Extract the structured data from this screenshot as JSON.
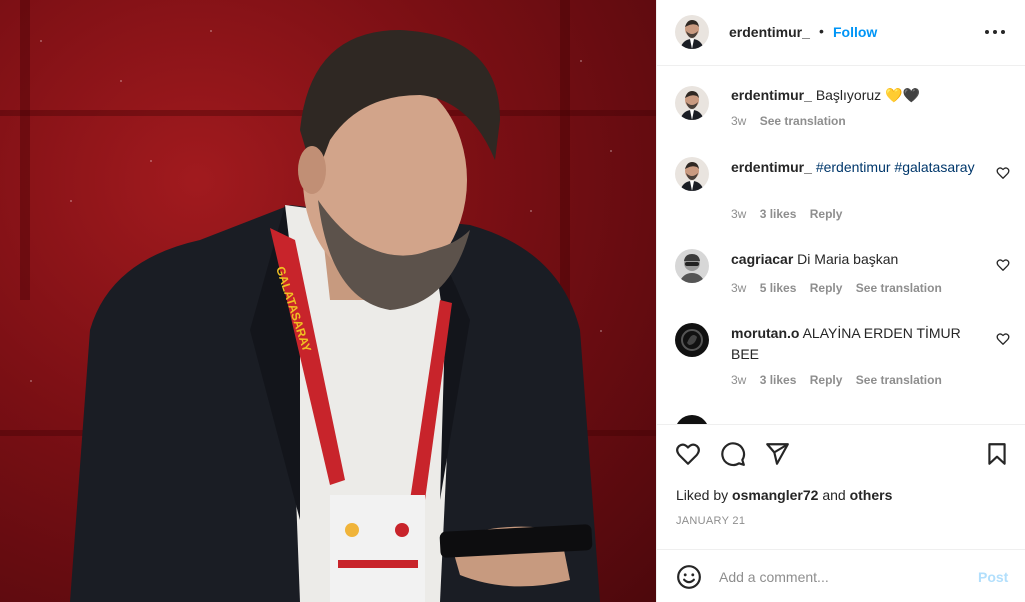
{
  "post": {
    "author": "erdentimur_",
    "separator": "•",
    "follow_label": "Follow",
    "more_icon": "more-horizontal-icon"
  },
  "caption": {
    "username": "erdentimur_",
    "text": "Başlıyoruz",
    "emoji": "💛🖤",
    "time": "3w",
    "translate": "See translation"
  },
  "comments": [
    {
      "username": "erdentimur_",
      "text": "#erdentimur #galatasaray",
      "time": "3w",
      "likes": "3 likes",
      "reply": "Reply",
      "translate": ""
    },
    {
      "username": "cagriacar",
      "text": "Di Maria başkan",
      "time": "3w",
      "likes": "5 likes",
      "reply": "Reply",
      "translate": "See translation"
    },
    {
      "username": "morutan.o",
      "text": "ALAYİNA ERDEN TİMUR BEE",
      "time": "3w",
      "likes": "3 likes",
      "reply": "Reply",
      "translate": "See translation"
    }
  ],
  "actions": {
    "like_icon": "heart-icon",
    "comment_icon": "comment-icon",
    "share_icon": "share-icon",
    "save_icon": "bookmark-icon",
    "liked_by_prefix": "Liked by",
    "liked_by_user": "osmangler72",
    "liked_by_and": "and",
    "liked_by_others": "others",
    "date": "JANUARY 21"
  },
  "add_comment": {
    "placeholder": "Add a comment...",
    "post_label": "Post",
    "emoji_icon": "smiley-icon"
  },
  "colors": {
    "link_blue": "#0095f6",
    "post_disabled": "#b2dffc",
    "muted": "#8e8e8e",
    "photo_bg": "#7a0f14",
    "lanyard": "#c8242b"
  },
  "photo": {
    "lanyard_text": "GALATASARAY"
  }
}
